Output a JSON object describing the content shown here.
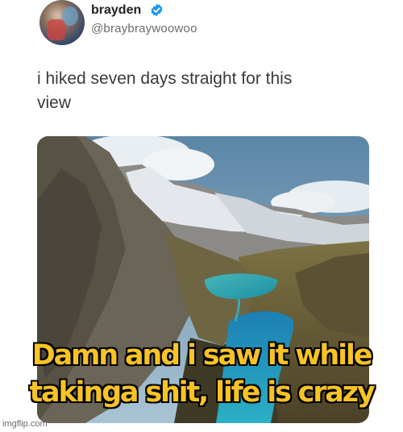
{
  "tweet": {
    "display_name": "brayden",
    "handle": "@braybraywoowoo",
    "text_line1": "i hiked seven days straight for this",
    "text_line2": "view",
    "verified_color": "#1d9bf0"
  },
  "meme_caption": {
    "line1": "Damn and i saw it while",
    "line2": "takinga shit, life is crazy",
    "color": "#f7c325"
  },
  "watermark": "imgflip.com",
  "icons": [
    "verified-badge-icon"
  ]
}
